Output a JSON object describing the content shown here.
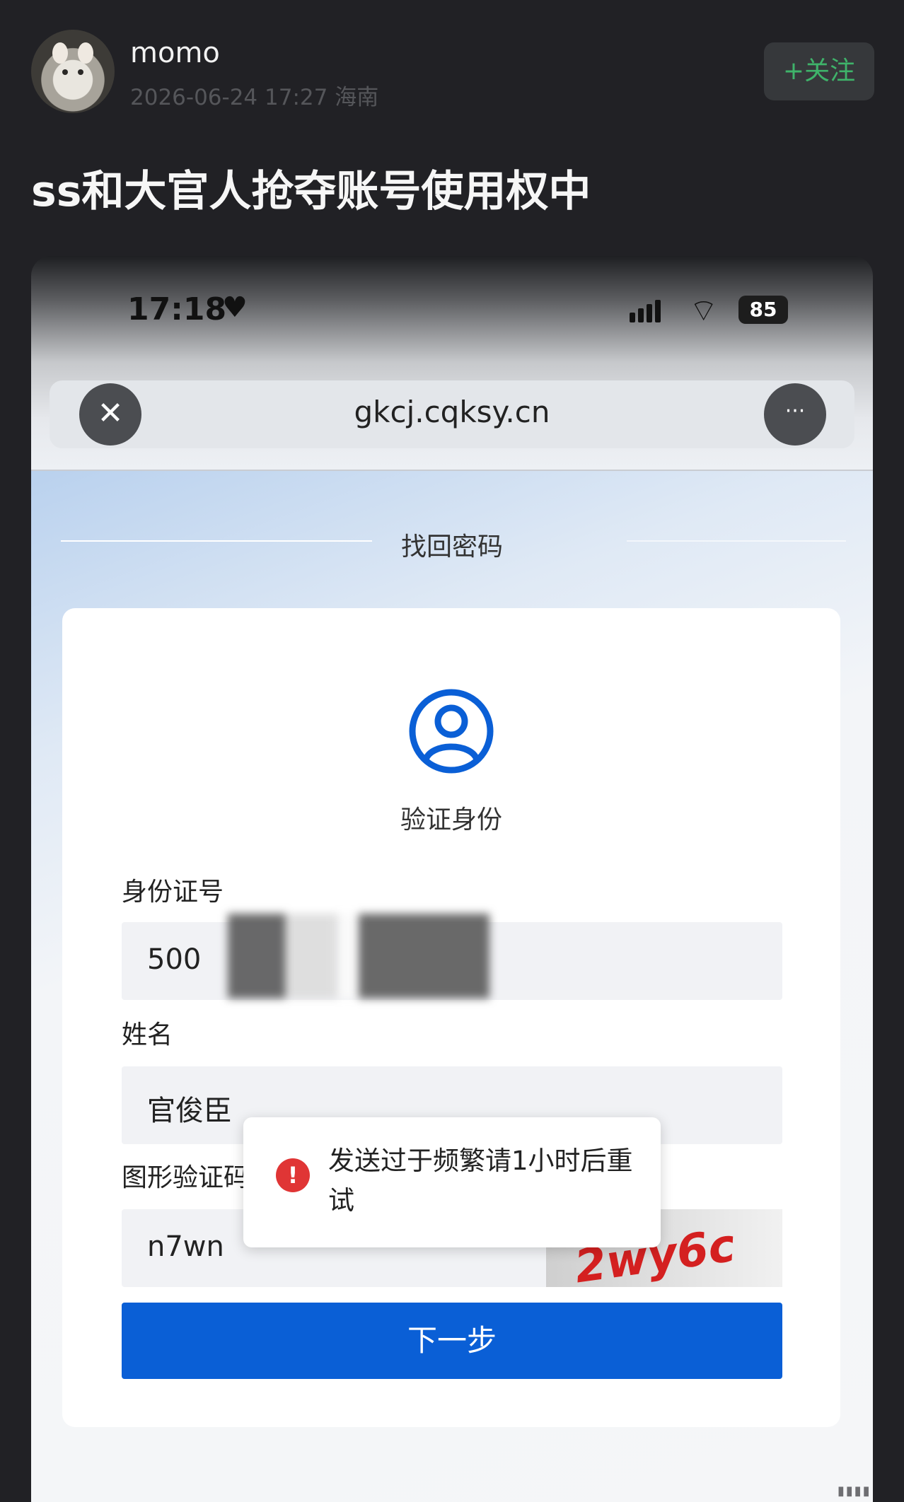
{
  "post": {
    "username": "momo",
    "meta": "2026-06-24 17:27  海南",
    "follow_label": "+关注",
    "title": "ss和大官人抢夺账号使用权中"
  },
  "phone": {
    "time": "17:18",
    "heart": "♥",
    "wifi": "⌔",
    "battery": "85",
    "url": "gkcj.cqksy.cn",
    "close_icon": "✕",
    "more_icon": "···"
  },
  "page": {
    "section_title": "找回密码",
    "card_title": "验证身份",
    "id_label": "身份证号",
    "id_value": "500",
    "name_label": "姓名",
    "name_value": "官俊臣",
    "captcha_label": "图形验证码",
    "captcha_value": "n7wn",
    "captcha_image_text": "2wy6c",
    "next_button": "下一步"
  },
  "toast": {
    "icon": "!",
    "message": "发送过于频繁请1小时后重试"
  },
  "colors": {
    "background": "#212125",
    "follow_green": "#3fb36a",
    "primary_blue": "#0a5fd6",
    "error_red": "#e03535"
  }
}
